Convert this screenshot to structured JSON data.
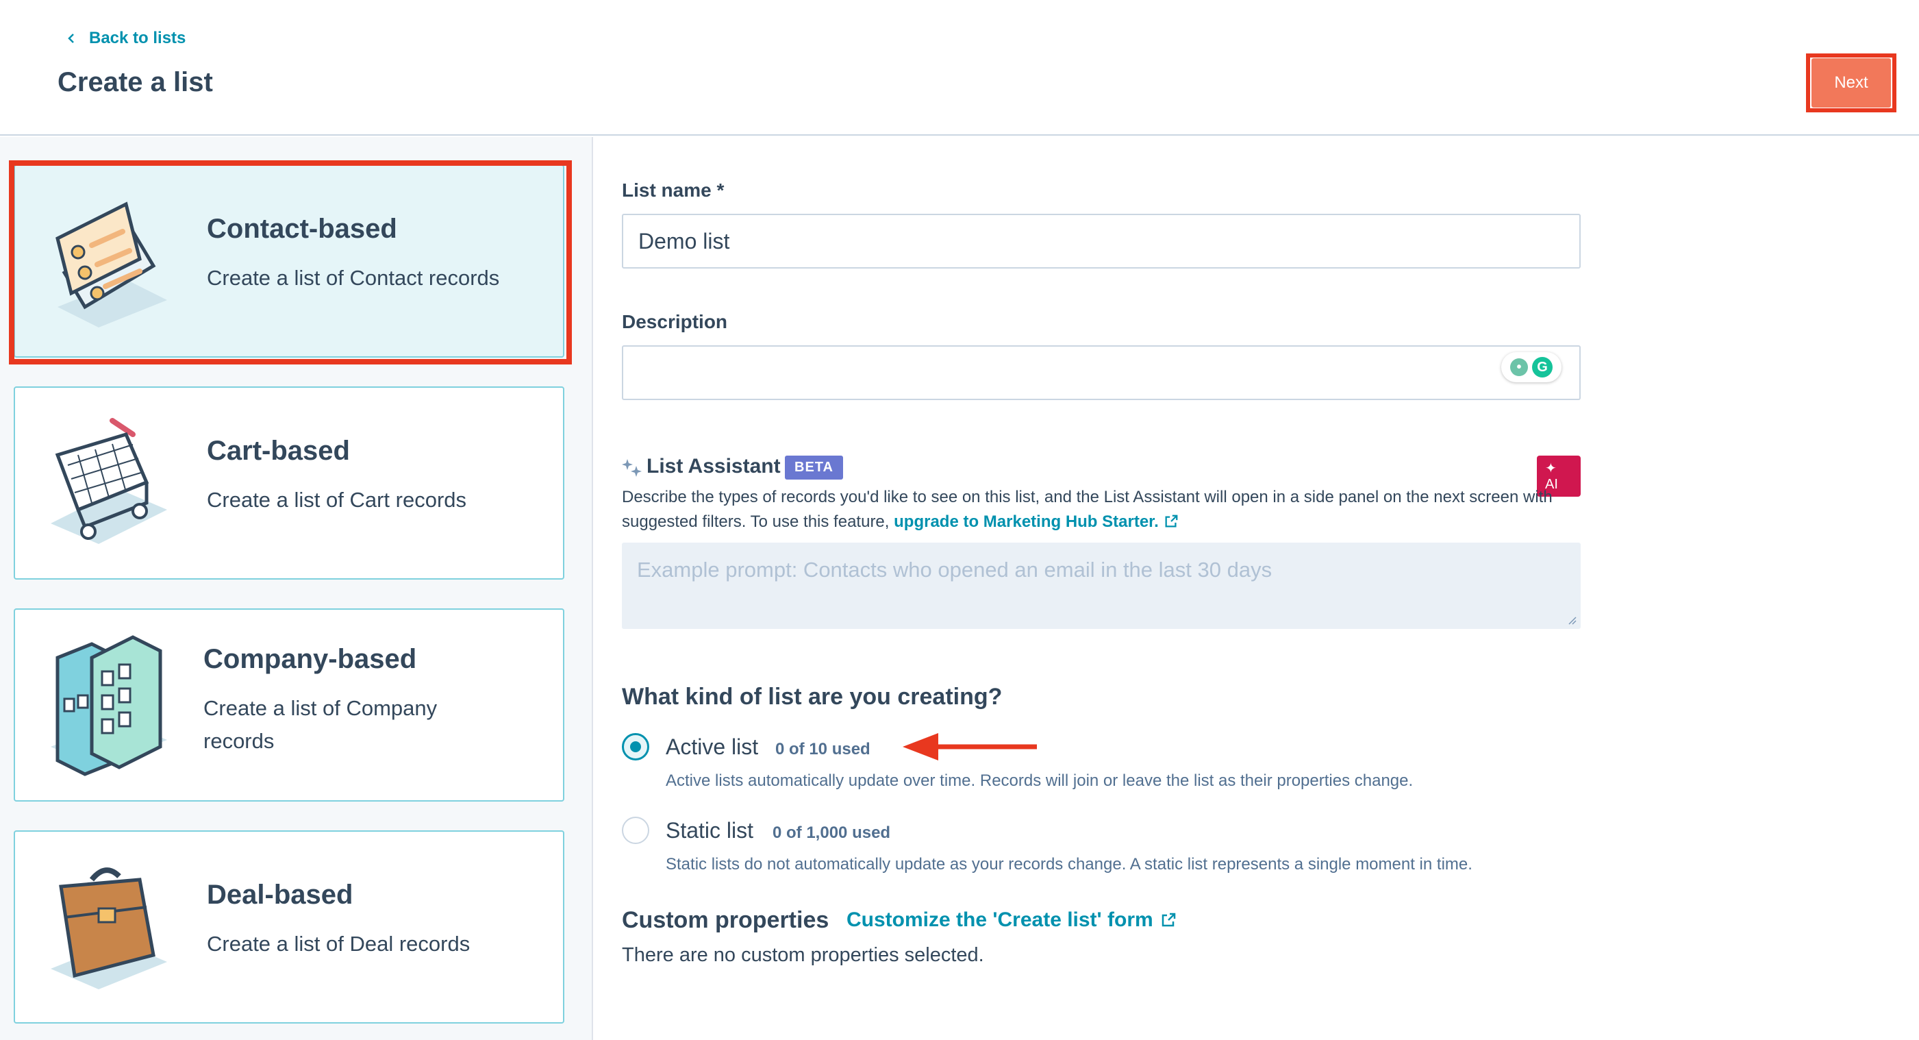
{
  "header": {
    "back_label": "Back to lists",
    "title": "Create a list",
    "next_label": "Next"
  },
  "list_types": [
    {
      "title": "Contact-based",
      "description": "Create a list of Contact records",
      "selected": true
    },
    {
      "title": "Cart-based",
      "description": "Create a list of Cart records",
      "selected": false
    },
    {
      "title": "Company-based",
      "description": "Create a list of Company records",
      "selected": false
    },
    {
      "title": "Deal-based",
      "description": "Create a list of Deal records",
      "selected": false
    }
  ],
  "form": {
    "list_name_label": "List name *",
    "list_name_value": "Demo list",
    "description_label": "Description",
    "description_value": "",
    "assistant": {
      "title": "List Assistant",
      "beta": "BETA",
      "ai_badge": "✦ AI",
      "text_before": "Describe the types of records you'd like to see on this list, and the List Assistant will open in a side panel on the next screen with suggested filters. To use this feature, ",
      "link": "upgrade to Marketing Hub Starter.",
      "placeholder": "Example prompt: Contacts who opened an email in the last 30 days"
    },
    "kind_question": "What kind of list are you creating?",
    "options": [
      {
        "label": "Active list",
        "count": "0 of 10 used",
        "description": "Active lists automatically update over time. Records will join or leave the list as their properties change.",
        "checked": true
      },
      {
        "label": "Static list",
        "count": "0 of 1,000 used",
        "description": "Static lists do not automatically update as your records change. A static list represents a single moment in time.",
        "checked": false
      }
    ],
    "custom_properties": {
      "title": "Custom properties",
      "link": "Customize the 'Create list' form",
      "empty": "There are no custom properties selected."
    }
  },
  "colors": {
    "accent": "#0091ae",
    "next_button": "#f2785a",
    "highlight": "#e8381f",
    "beta": "#6a78d1",
    "ai": "#d0174f"
  }
}
